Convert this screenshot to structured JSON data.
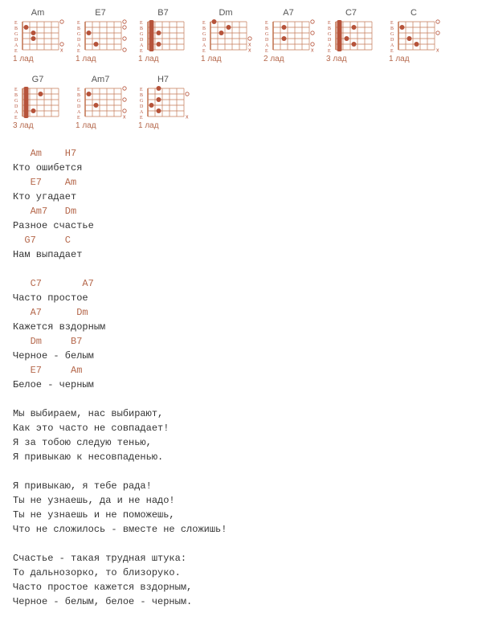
{
  "chart_data": {
    "type": "table",
    "title": "Guitar chord diagrams",
    "string_labels": [
      "E",
      "B",
      "G",
      "D",
      "A",
      "E"
    ],
    "chords": [
      {
        "name": "Am",
        "fret_label": "1 лад",
        "dots": [
          [
            1,
            2
          ],
          [
            2,
            3
          ],
          [
            2,
            4
          ]
        ],
        "open": [
          1,
          5
        ],
        "mute": [
          6
        ],
        "barre": null
      },
      {
        "name": "E7",
        "fret_label": "1 лад",
        "dots": [
          [
            1,
            3
          ],
          [
            2,
            5
          ]
        ],
        "open": [
          1,
          2,
          4,
          6
        ],
        "mute": [],
        "barre": null
      },
      {
        "name": "B7",
        "fret_label": "1 лад",
        "dots": [
          [
            2,
            3
          ],
          [
            2,
            5
          ]
        ],
        "open": [],
        "mute": [],
        "barre": {
          "fret": 1,
          "from": 1,
          "to": 6
        }
      },
      {
        "name": "Dm",
        "fret_label": "1 лад",
        "dots": [
          [
            1,
            1
          ],
          [
            2,
            3
          ],
          [
            3,
            2
          ]
        ],
        "open": [
          4
        ],
        "mute": [
          5,
          6
        ],
        "barre": null
      },
      {
        "name": "A7",
        "fret_label": "2 лад",
        "dots": [
          [
            2,
            2
          ],
          [
            2,
            4
          ]
        ],
        "open": [
          1,
          3,
          5
        ],
        "mute": [
          6
        ],
        "barre": null
      },
      {
        "name": "C7",
        "fret_label": "3 лад",
        "dots": [
          [
            2,
            4
          ],
          [
            3,
            2
          ],
          [
            3,
            5
          ]
        ],
        "open": [],
        "mute": [],
        "barre": {
          "fret": 1,
          "from": 1,
          "to": 6
        }
      },
      {
        "name": "C",
        "fret_label": "1 лад",
        "dots": [
          [
            1,
            2
          ],
          [
            2,
            4
          ],
          [
            3,
            5
          ]
        ],
        "open": [
          1,
          3
        ],
        "mute": [
          6
        ],
        "barre": null
      },
      {
        "name": "G7",
        "fret_label": "3 лад",
        "dots": [
          [
            2,
            5
          ],
          [
            3,
            2
          ]
        ],
        "open": [],
        "mute": [],
        "barre": {
          "fret": 1,
          "from": 1,
          "to": 6
        }
      },
      {
        "name": "Am7",
        "fret_label": "1 лад",
        "dots": [
          [
            1,
            2
          ],
          [
            2,
            4
          ]
        ],
        "open": [
          1,
          3,
          5
        ],
        "mute": [
          6
        ],
        "barre": null
      },
      {
        "name": "H7",
        "fret_label": "1 лад",
        "dots": [
          [
            1,
            4
          ],
          [
            2,
            1
          ],
          [
            2,
            3
          ],
          [
            2,
            5
          ]
        ],
        "open": [
          2
        ],
        "mute": [
          6
        ],
        "barre": null
      }
    ]
  },
  "lyrics": [
    {
      "chords": "   Am    H7",
      "text": "Кто ошибется"
    },
    {
      "chords": "   E7    Am",
      "text": "Кто угадает"
    },
    {
      "chords": "   Am7   Dm",
      "text": "Разное счастье"
    },
    {
      "chords": "  G7     C",
      "text": "Нам выпадает"
    },
    {
      "chords": "",
      "text": ""
    },
    {
      "chords": "   C7       A7",
      "text": "Часто простое"
    },
    {
      "chords": "   A7      Dm",
      "text": "Кажется вздорным"
    },
    {
      "chords": "   Dm     B7",
      "text": "Черное - белым"
    },
    {
      "chords": "   E7     Am",
      "text": "Белое - черным"
    },
    {
      "chords": "",
      "text": ""
    },
    {
      "chords": null,
      "text": "Мы выбираем, нас выбирают,"
    },
    {
      "chords": null,
      "text": "Как это часто не совпадает!"
    },
    {
      "chords": null,
      "text": "Я за тобою следую тенью,"
    },
    {
      "chords": null,
      "text": "Я привыкаю к несовпаденью."
    },
    {
      "chords": null,
      "text": ""
    },
    {
      "chords": null,
      "text": "Я привыкаю, я тебе рада!"
    },
    {
      "chords": null,
      "text": "Ты не узнаешь, да и не надо!"
    },
    {
      "chords": null,
      "text": "Ты не узнаешь и не поможешь,"
    },
    {
      "chords": null,
      "text": "Что не сложилось - вместе не сложишь!"
    },
    {
      "chords": null,
      "text": ""
    },
    {
      "chords": null,
      "text": "Счастье - такая трудная штука:"
    },
    {
      "chords": null,
      "text": "То дальнозорко, то близоруко."
    },
    {
      "chords": null,
      "text": "Часто простое кажется вздорным,"
    },
    {
      "chords": null,
      "text": "Черное - белым, белое - черным."
    }
  ]
}
